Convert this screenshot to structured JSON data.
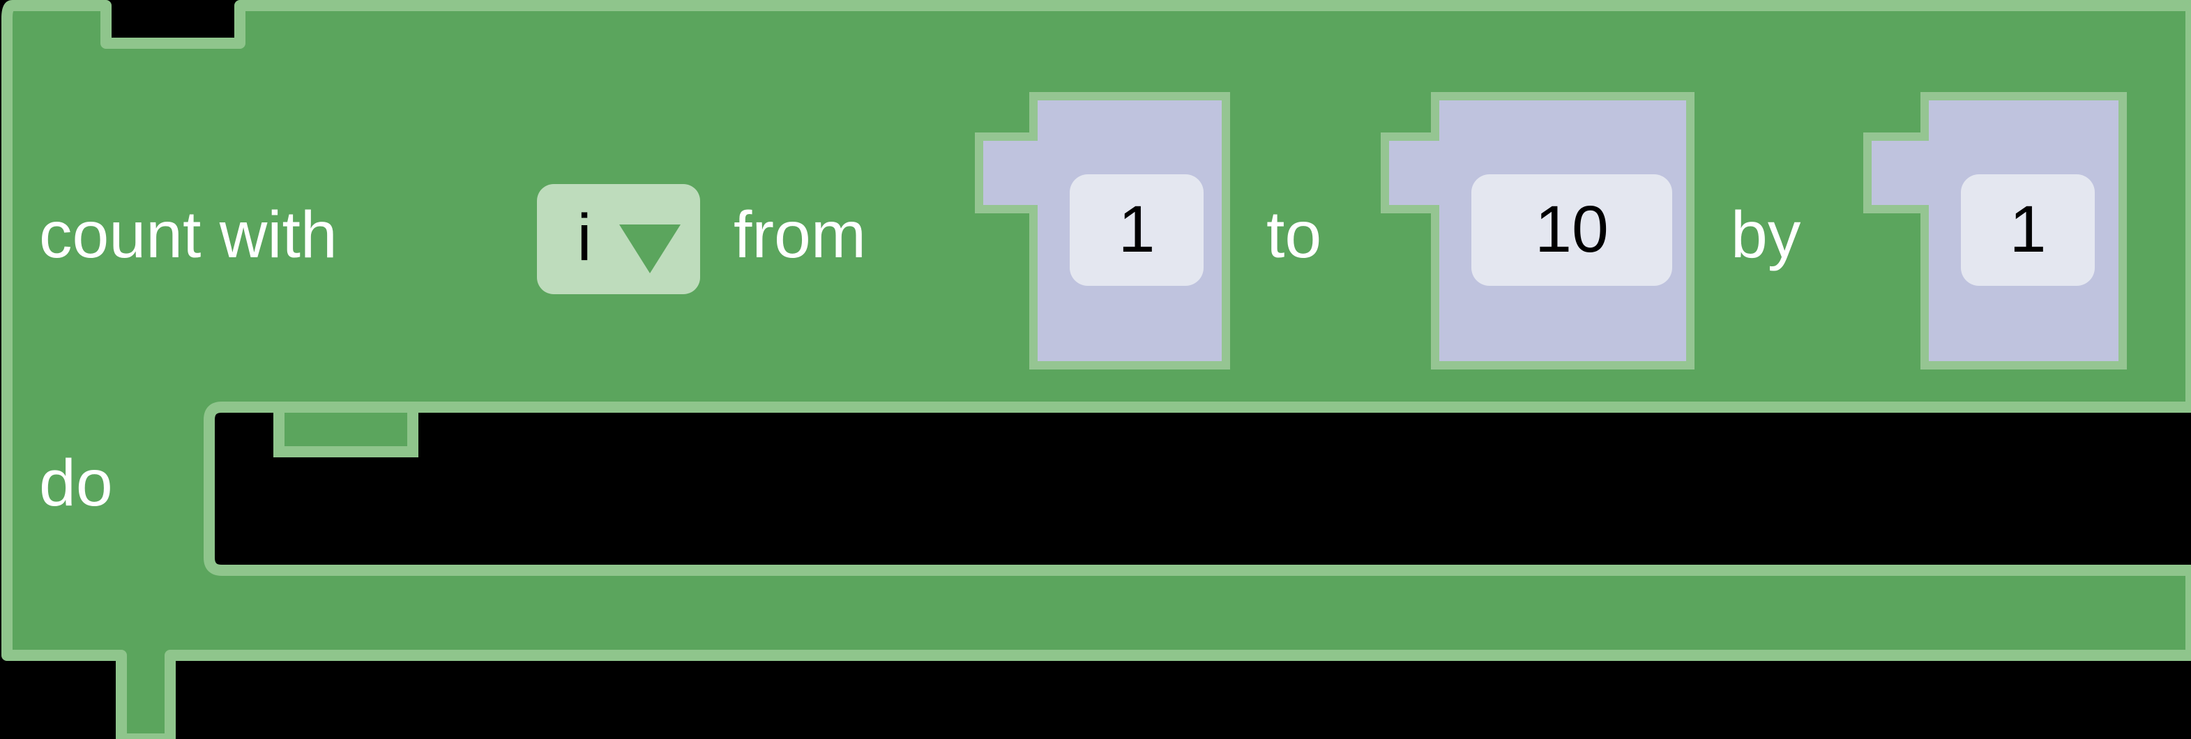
{
  "block": {
    "kind": "controls_forRange",
    "type_label": "count with",
    "colors": {
      "block_fill": "#5BA55D",
      "block_stroke": "#8FC58C",
      "value_block_fill": "#BFC3DE",
      "value_block_stroke": "#95C592",
      "value_field_fill": "#E4E7F0",
      "dropdown_field_fill": "#BEDCBC",
      "dropdown_arrow": "#5BA55D",
      "label_text": "#FFFFFF",
      "field_text": "#000000",
      "canvas": "#000000"
    },
    "labels": {
      "count_with": "count with",
      "from": "from",
      "to": "to",
      "by": "by",
      "do": "do"
    },
    "variable_field": {
      "name": "variable-dropdown",
      "value": "i",
      "arrow": "▼"
    },
    "inputs": [
      {
        "name": "from",
        "label": "from",
        "value": "1"
      },
      {
        "name": "to",
        "label": "to",
        "value": "10"
      },
      {
        "name": "by",
        "label": "by",
        "value": "1"
      }
    ],
    "statement_input": {
      "label": "do",
      "empty": true
    }
  }
}
